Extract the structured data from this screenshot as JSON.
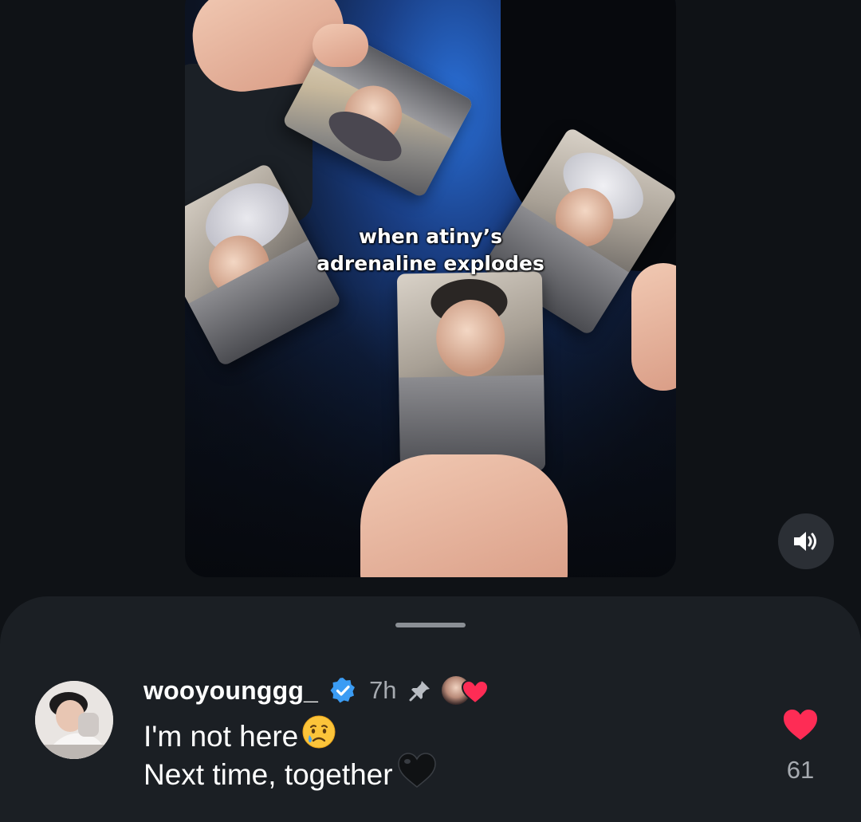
{
  "video": {
    "caption_line1": "when atiny’s",
    "caption_line2": "adrenaline explodes",
    "sound_icon": "speaker-on-icon"
  },
  "comment": {
    "username": "wooyounggg_",
    "verified_icon": "verified-badge-icon",
    "time": "7h",
    "pin_icon": "pin-icon",
    "liked_by_creator_icon": "creator-liked-heart-icon",
    "line1": "I'm not here",
    "line1_emoji": "😢",
    "line2": "Next time, together",
    "line2_emoji": "🖤",
    "likes": "61",
    "like_icon": "heart-icon"
  },
  "colors": {
    "background": "#0f1216",
    "sheet": "#1b1f24",
    "text_primary": "#ffffff",
    "text_secondary": "#a6aab0",
    "verified_blue": "#3b9cf4",
    "like_red": "#fe2c55"
  }
}
